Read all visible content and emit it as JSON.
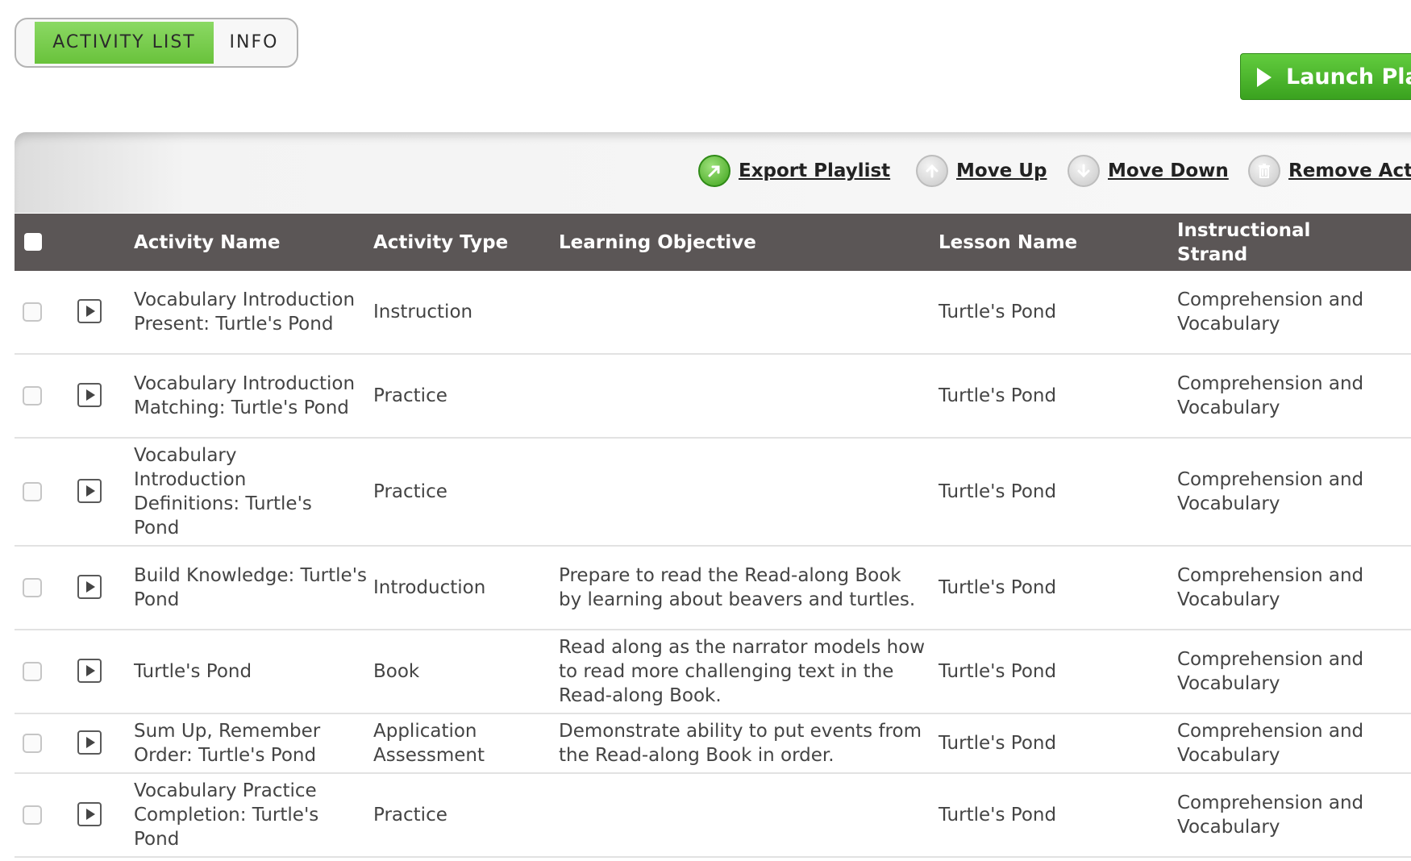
{
  "tabs": [
    {
      "label": "ACTIVITY LIST",
      "active": true
    },
    {
      "label": "INFO",
      "active": false
    }
  ],
  "launch_button": {
    "label": "Launch Pla",
    "color": "#4cb52b"
  },
  "toolbar": {
    "export": {
      "label": "Export Playlist",
      "icon": "export-icon"
    },
    "move_up": {
      "label": "Move Up",
      "icon": "arrow-up-icon"
    },
    "move_down": {
      "label": "Move Down",
      "icon": "arrow-down-icon"
    },
    "remove": {
      "label": "Remove Act",
      "icon": "trash-icon"
    }
  },
  "table": {
    "headers": {
      "activity_name": "Activity Name",
      "activity_type": "Activity Type",
      "learning_objective": "Learning Objective",
      "lesson_name": "Lesson Name",
      "instructional_strand": "Instructional Strand"
    },
    "rows": [
      {
        "activity_name": "Vocabulary Introduction Present: Turtle's Pond",
        "activity_type": "Instruction",
        "learning_objective": "",
        "lesson_name": "Turtle's Pond",
        "instructional_strand": "Comprehension and Vocabulary"
      },
      {
        "activity_name": "Vocabulary Introduction Matching: Turtle's Pond",
        "activity_type": "Practice",
        "learning_objective": "",
        "lesson_name": "Turtle's Pond",
        "instructional_strand": "Comprehension and Vocabulary"
      },
      {
        "activity_name": "Vocabulary Introduction Definitions: Turtle's Pond",
        "activity_type": "Practice",
        "learning_objective": "",
        "lesson_name": "Turtle's Pond",
        "instructional_strand": "Comprehension and Vocabulary"
      },
      {
        "activity_name": "Build Knowledge: Turtle's Pond",
        "activity_type": "Introduction",
        "learning_objective": "Prepare to read the Read-along Book by learning about beavers and turtles.",
        "lesson_name": "Turtle's Pond",
        "instructional_strand": "Comprehension and Vocabulary"
      },
      {
        "activity_name": "Turtle's Pond",
        "activity_type": "Book",
        "learning_objective": "Read along as the narrator models how to read more challenging text in the Read-along Book.",
        "lesson_name": "Turtle's Pond",
        "instructional_strand": "Comprehension and Vocabulary"
      },
      {
        "activity_name": "Sum Up, Remember Order: Turtle's Pond",
        "activity_type": "Application Assessment",
        "learning_objective": "Demonstrate ability to put events from the Read-along Book in order.",
        "lesson_name": "Turtle's Pond",
        "instructional_strand": "Comprehension and Vocabulary"
      },
      {
        "activity_name": "Vocabulary Practice Completion: Turtle's Pond",
        "activity_type": "Practice",
        "learning_objective": "",
        "lesson_name": "Turtle's Pond",
        "instructional_strand": "Comprehension and Vocabulary"
      }
    ]
  }
}
